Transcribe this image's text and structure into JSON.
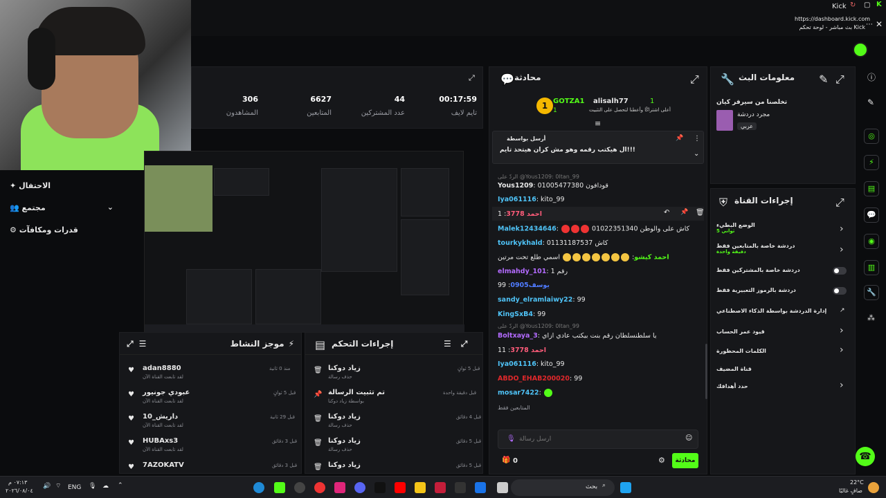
{
  "browser": {
    "title": "Kick",
    "url": "https://dashboard.kick.com",
    "tab_title": "بث مباشر - لوحة تحكم Kick"
  },
  "stats": [
    {
      "value": "306",
      "label": "المشاهدون"
    },
    {
      "value": "6627",
      "label": "المتابعين"
    },
    {
      "value": "44",
      "label": "عدد المشتركين"
    },
    {
      "value": "00:17:59",
      "label": "تايم لايف"
    }
  ],
  "sidenav": {
    "items": [
      "الاحتفال",
      "مجتمع",
      "قدرات ومكافآت"
    ]
  },
  "activity_feed": {
    "title": "موجز النشاط",
    "items": [
      {
        "name": "adan8880",
        "sub": "لقد تابعت القناة الآن",
        "time": "منذ 0 ثانية"
      },
      {
        "name": "عبودي جونيور",
        "sub": "لقد تابعت القناة الآن",
        "time": "قبل 5 ثوانٍ"
      },
      {
        "name": "داريش_10",
        "sub": "لقد تابعت القناة الآن",
        "time": "قبل 29 ثانية"
      },
      {
        "name": "HUBAxs3",
        "sub": "لقد تابعت القناة الآن",
        "time": "قبل 3 دقائق"
      },
      {
        "name": "7AZOKATV",
        "sub": "",
        "time": "قبل 3 دقائق"
      }
    ]
  },
  "mod_actions": {
    "title": "إجراءات التحكم",
    "items": [
      {
        "name": "زياد دوكنا",
        "sub": "حذف رسالة",
        "time": "قبل 5 ثوانٍ"
      },
      {
        "name": "تم تثبيت الرسالة",
        "sub": "بواسطة زياد دوكنا",
        "time": "قبل دقيقة واحدة"
      },
      {
        "name": "زياد دوكنا",
        "sub": "حذف رسالة",
        "time": "قبل 4 دقائق"
      },
      {
        "name": "زياد دوكنا",
        "sub": "حذف رسالة",
        "time": "قبل 5 دقائق"
      },
      {
        "name": "زياد دوكنا",
        "sub": "",
        "time": "قبل 5 دقائق"
      }
    ]
  },
  "chat": {
    "title": "محادثة",
    "top_gifters": [
      {
        "rank": "1",
        "name": "GOTZA1",
        "count": "1"
      },
      {
        "rank": "1",
        "name": "alisalh77",
        "note": "أعلى اشتراكًا وأعطنا لتحصل على التثبيت"
      }
    ],
    "pinned": {
      "by": "أرسل بواسطة",
      "text": "ال هيكتب رقمه وهو مش كران هيتحذ تايم!!!"
    },
    "messages": [
      {
        "reply": "الردّ على @Yous1209: 0ltan_99",
        "user": "",
        "text": ""
      },
      {
        "user": "Yous1209",
        "text": "قودافون 01005477380",
        "color": "#e8e8e8"
      },
      {
        "user": "Iya061116",
        "text": "kito_99",
        "color": "#4fc3f7"
      },
      {
        "user": "احمد 3778",
        "text": "1",
        "color": "#ff5c7a"
      },
      {
        "user": "Malek12434646",
        "text": "كاش على والوطن 01022351340",
        "color": "#4fc3f7"
      },
      {
        "user": "tourkykhald",
        "text": "كاش 01131187537",
        "color": "#4fc3f7"
      },
      {
        "user": "احمد كيشو",
        "text": "اسمي طلع تحت مرتين",
        "color": "#53fc18"
      },
      {
        "user": "elmahdy_101",
        "text": "رقم 1",
        "color": "#b36bff"
      },
      {
        "user": "يوسف0905",
        "text": "99",
        "color": "#4f7bff"
      },
      {
        "user": "sandy_elramlaiwy22",
        "text": "99",
        "color": "#4fc3f7"
      },
      {
        "user": "KingSxB4",
        "text": "99",
        "color": "#4fc3f7"
      },
      {
        "reply": "الردّ على @Yous1209: 0ltan_99",
        "user": "",
        "text": ""
      },
      {
        "user": "Boltxaya_3",
        "text": "يا سلطنسلطان رقم بنت بيكتب عادي ازاي",
        "color": "#b36bff"
      },
      {
        "user": "احمد 3778",
        "text": "11",
        "color": "#ff5c7a"
      },
      {
        "user": "Iya061116",
        "text": "kito_99",
        "color": "#4fc3f7"
      },
      {
        "user": "ABDO_EHAB200020",
        "text": "99",
        "color": "#e0282b"
      },
      {
        "user": "mosar7422",
        "text": "",
        "color": "#4fc3f7"
      }
    ],
    "followers_only": "المتابعين فقط",
    "input_placeholder": "أرسل رسالة",
    "send_label": "محادثة",
    "points": "0"
  },
  "stream_info": {
    "title": "معلومات البث",
    "stream_title": "تخلصنا من سيرفر كيان",
    "category": "مجرد دردشة",
    "language": "عربي"
  },
  "channel_actions": {
    "title": "إجراءات القناة",
    "items": [
      {
        "label": "الوضع البطيء",
        "sub": "5 ثواني",
        "control": "chevron"
      },
      {
        "label": "دردشة خاصة بالمتابعين فقط",
        "sub": "دقيقة واحدة",
        "control": "chevron"
      },
      {
        "label": "دردشة خاصة بالمشتركين فقط",
        "sub": "",
        "control": "toggle"
      },
      {
        "label": "دردشة بالرموز التعبيرية فقط",
        "sub": "",
        "control": "toggle"
      },
      {
        "label": "إدارة الدردشة بواسطة الذكاء الاصطناعي",
        "sub": "",
        "control": "external"
      },
      {
        "label": "قيود عمر الحساب",
        "sub": "",
        "control": "chevron"
      },
      {
        "label": "الكلمات المحظورة",
        "sub": "",
        "control": "chevron"
      },
      {
        "label": "قناة المضيف",
        "sub": "",
        "control": "none"
      },
      {
        "label": "حدد أهدافك",
        "sub": "",
        "control": "chevron"
      }
    ]
  },
  "taskbar": {
    "time": "٠٧:١٣ م",
    "date": "٢٠٢٦/٠٨/٠٤",
    "lang": "ENG",
    "search": "بحث",
    "weather_temp": "22°C",
    "weather_text": "صافٍ غالبًا"
  }
}
